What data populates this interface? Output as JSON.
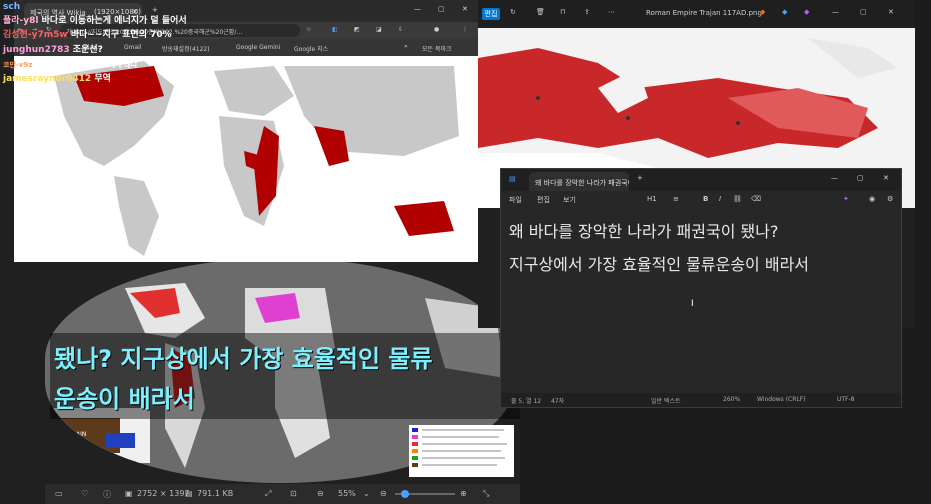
{
  "viewer": {
    "toolbar": {
      "dimensions": "2752 × 1397",
      "filesize": "791.1 KB",
      "zoom": "55%"
    }
  },
  "roman": {
    "title": "Roman Empire Trajan 117AD.png",
    "edit_label": "편집"
  },
  "browser": {
    "tab_label": "제국의 역사 Wikia",
    "tab_title2": "(1920×1080)",
    "address": "가 http://지도/편%20자료%20준비/102.%20중국해군%20근황/…",
    "bookmarks": [
      "Play…",
      "Gmail",
      "방송재설정(4122)",
      "Google Gemini",
      "Google 지스"
    ],
    "bm_more": "모든 북마크"
  },
  "chat": [
    {
      "name": "sch",
      "color": "#7ab8ff",
      "msg": ""
    },
    {
      "name": "플라-y8l",
      "color": "#ffb0d0",
      "msg": "바다로 이동하는게 에너지가 덜 들어서"
    },
    {
      "name": "김성현-y7m5w",
      "color": "#ff6060",
      "msg": "바다~~지구 표면의 70%"
    },
    {
      "name": "junghun2783",
      "color": "#ff9de0",
      "msg": "조운선?"
    },
    {
      "name": "코만-v9z",
      "color": "#ffa060",
      "msg": "제도 특수를 가진 정도 그에게 대니"
    },
    {
      "name": "jamesraynor0412",
      "color": "#ffe060",
      "msg": "무역"
    }
  ],
  "notepad": {
    "title": "왜 바다를 장악한 나라가 패권국이 ",
    "menu": [
      "파일",
      "편집",
      "보기"
    ],
    "heading_label": "H1",
    "line1": "왜 바다를 장악한 나라가 패권국이 됐나?",
    "line2": "지구상에서 가장 효율적인 물류운송이 배라서",
    "status": {
      "position": "줄 5, 열 12",
      "chars": "47자",
      "zoom": "260%",
      "eol": "Windows (CRLF)",
      "encoding": "UTF-8",
      "plain": "일반 텍스트"
    }
  },
  "subtitle": {
    "line1": "됐나? 지구상에서 가장 효율적인 물류",
    "line2": "운송이 배라서"
  },
  "colors": {
    "accent": "#0078d4",
    "subtitle": "#7df0ff",
    "empire_red": "#c8282a",
    "british_red": "#b00000"
  }
}
